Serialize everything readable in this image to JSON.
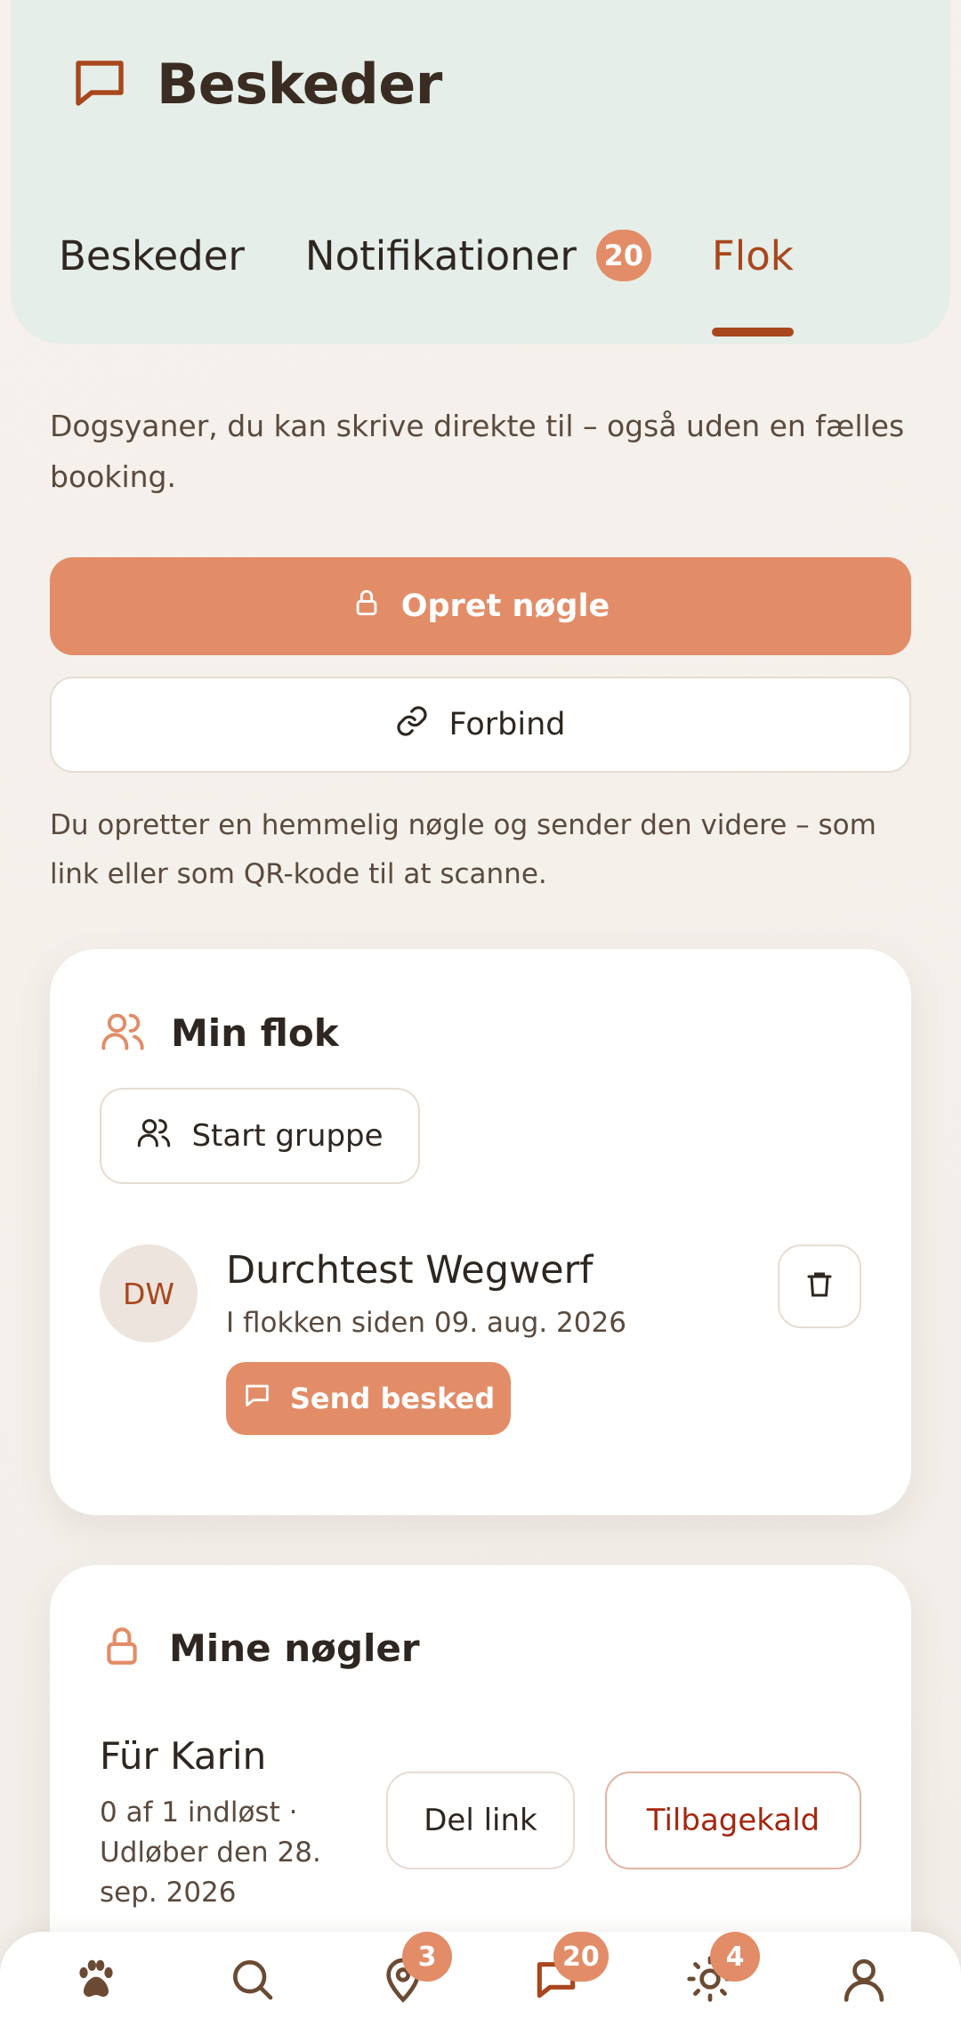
{
  "header": {
    "title": "Beskeder",
    "title_icon": "message-square-icon",
    "tabs": [
      {
        "label": "Beskeder",
        "active": false
      },
      {
        "label": "Notifikationer",
        "badge": "20",
        "active": false
      },
      {
        "label": "Flok",
        "active": true
      }
    ]
  },
  "intro": "Dogsyaner, du kan skrive direkte til – også uden en fælles booking.",
  "actions": {
    "create_key_label": "Opret nøgle",
    "create_key_icon": "lock-icon",
    "connect_label": "Forbind",
    "connect_icon": "link-icon"
  },
  "note": "Du opretter en hemmelig nøgle og sender den videre – som link eller som QR-kode til at scanne.",
  "flock": {
    "title": "Min flok",
    "title_icon": "users-icon",
    "start_group_label": "Start gruppe",
    "members": [
      {
        "initials": "DW",
        "name": "Durchtest Wegwerf",
        "since": "I flokken siden 09. aug. 2026",
        "send_label": "Send besked"
      }
    ]
  },
  "keys": {
    "title": "Mine nøgler",
    "title_icon": "lock-icon",
    "items": [
      {
        "name": "Für Karin",
        "meta": "0 af 1 indløst · Udløber den 28. sep. 2026",
        "share_label": "Del link",
        "revoke_label": "Tilbagekald"
      }
    ]
  },
  "bottom_nav": {
    "items": [
      {
        "icon": "paw-icon",
        "badge": null,
        "active": false
      },
      {
        "icon": "search-icon",
        "badge": null,
        "active": false
      },
      {
        "icon": "map-pin-icon",
        "badge": "3",
        "active": false
      },
      {
        "icon": "message-square-icon",
        "badge": "20",
        "active": true
      },
      {
        "icon": "sun-icon",
        "badge": "4",
        "active": false
      },
      {
        "icon": "user-icon",
        "badge": null,
        "active": false
      }
    ]
  },
  "colors": {
    "accent": "#e28d68",
    "accent_dark": "#a8471d",
    "header_bg": "#e6eee9",
    "danger": "#a3270f"
  }
}
